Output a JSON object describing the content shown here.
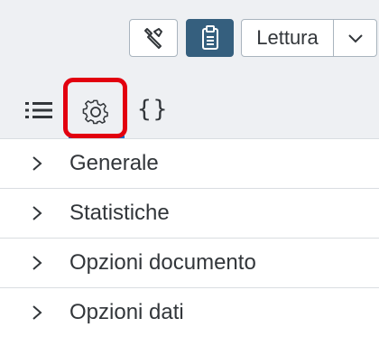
{
  "toolbar": {
    "tool_icon": "wrench-icon",
    "doc_icon": "clipboard-icon",
    "mode_label": "Lettura",
    "mode_arrow_icon": "chevron-down-icon"
  },
  "tabs": [
    {
      "icon": "list-icon",
      "selected": false
    },
    {
      "icon": "gear-icon",
      "selected": true
    },
    {
      "icon": "braces-icon",
      "label": "{}",
      "selected": false
    }
  ],
  "sections": [
    {
      "label": "Generale"
    },
    {
      "label": "Statistiche"
    },
    {
      "label": "Opzioni documento"
    },
    {
      "label": "Opzioni dati"
    }
  ],
  "colors": {
    "accent": "#0a6ed1",
    "highlight": "#e2000f",
    "primary_button": "#355f7e"
  }
}
